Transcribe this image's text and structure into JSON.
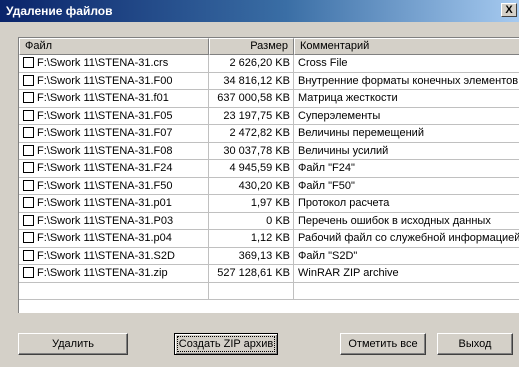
{
  "window": {
    "title": "Удаление файлов",
    "close_label": "X"
  },
  "table": {
    "columns": [
      "Файл",
      "Размер",
      "Комментарий"
    ],
    "rows": [
      {
        "file": "F:\\Swork 11\\STENA-31.crs",
        "size": "2 626,20 KB",
        "comment": "Cross File"
      },
      {
        "file": "F:\\Swork 11\\STENA-31.F00",
        "size": "34 816,12 KB",
        "comment": "Внутренние форматы конечных элементов"
      },
      {
        "file": "F:\\Swork 11\\STENA-31.f01",
        "size": "637 000,58 KB",
        "comment": "Матрица жесткости"
      },
      {
        "file": "F:\\Swork 11\\STENA-31.F05",
        "size": "23 197,75 KB",
        "comment": "Суперэлементы"
      },
      {
        "file": "F:\\Swork 11\\STENA-31.F07",
        "size": "2 472,82 KB",
        "comment": "Величины перемещений"
      },
      {
        "file": "F:\\Swork 11\\STENA-31.F08",
        "size": "30 037,78 KB",
        "comment": "Величины усилий"
      },
      {
        "file": "F:\\Swork 11\\STENA-31.F24",
        "size": "4 945,59 KB",
        "comment": "Файл \"F24\""
      },
      {
        "file": "F:\\Swork 11\\STENA-31.F50",
        "size": "430,20 KB",
        "comment": "Файл \"F50\""
      },
      {
        "file": "F:\\Swork 11\\STENA-31.p01",
        "size": "1,97 KB",
        "comment": "Протокол расчета"
      },
      {
        "file": "F:\\Swork 11\\STENA-31.P03",
        "size": "0 KB",
        "comment": "Перечень ошибок в исходных данных"
      },
      {
        "file": "F:\\Swork 11\\STENA-31.p04",
        "size": "1,12 KB",
        "comment": "Рабочий файл со служебной информацией"
      },
      {
        "file": "F:\\Swork 11\\STENA-31.S2D",
        "size": "369,13 KB",
        "comment": "Файл \"S2D\""
      },
      {
        "file": "F:\\Swork 11\\STENA-31.zip",
        "size": "527 128,61 KB",
        "comment": "WinRAR ZIP archive"
      }
    ]
  },
  "buttons": {
    "delete": "Удалить",
    "zip": "Создать ZIP архив",
    "check_all": "Отметить все",
    "exit": "Выход"
  }
}
